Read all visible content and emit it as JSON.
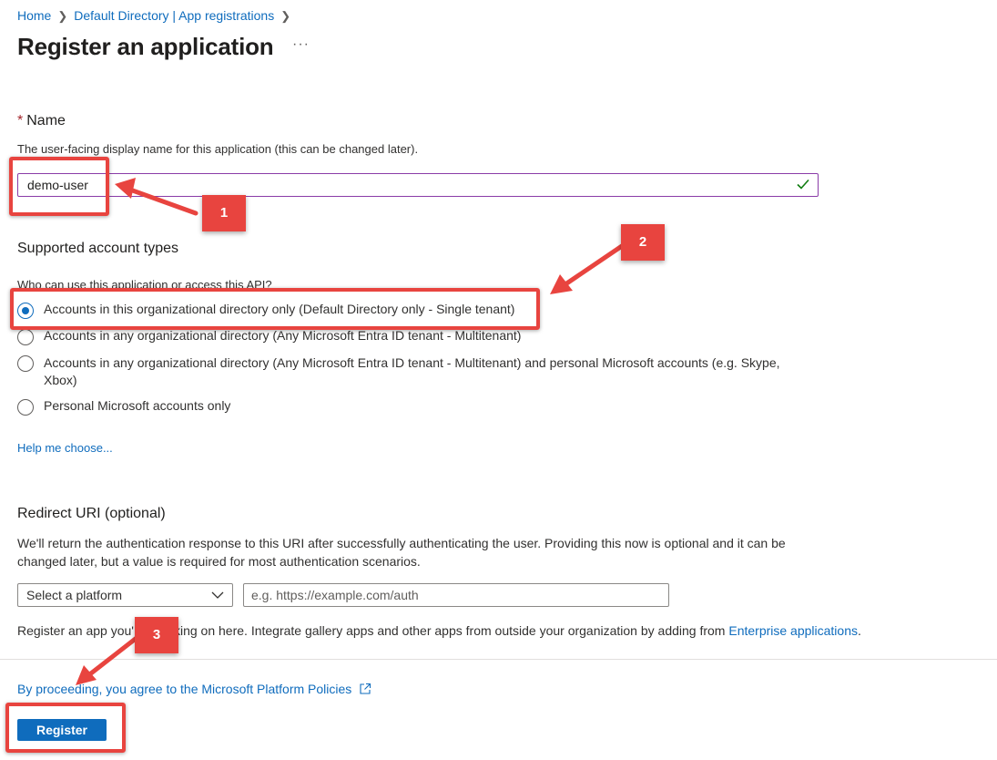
{
  "breadcrumb": {
    "items": [
      "Home",
      "Default Directory | App registrations"
    ]
  },
  "page": {
    "title": "Register an application",
    "more_label": "···"
  },
  "name_section": {
    "required_mark": "*",
    "label": "Name",
    "help": "The user-facing display name for this application (this can be changed later).",
    "value": "demo-user",
    "valid_icon": "checkmark-icon"
  },
  "account_types": {
    "label": "Supported account types",
    "question": "Who can use this application or access this API?",
    "options": [
      {
        "label": "Accounts in this organizational directory only (Default Directory only - Single tenant)",
        "selected": true
      },
      {
        "label": "Accounts in any organizational directory (Any Microsoft Entra ID tenant - Multitenant)",
        "selected": false
      },
      {
        "label": "Accounts in any organizational directory (Any Microsoft Entra ID tenant - Multitenant) and personal Microsoft accounts (e.g. Skype, Xbox)",
        "selected": false
      },
      {
        "label": "Personal Microsoft accounts only",
        "selected": false
      }
    ],
    "help_link": "Help me choose..."
  },
  "redirect": {
    "label": "Redirect URI (optional)",
    "description": "We'll return the authentication response to this URI after successfully authenticating the user. Providing this now is optional and it can be changed later, but a value is required for most authentication scenarios.",
    "platform_select": "Select a platform",
    "uri_placeholder": "e.g. https://example.com/auth"
  },
  "footer_note": {
    "text_a": "Register an app you'",
    "text_b": "king on here. Integrate gallery apps and other apps from outside your organization by adding from ",
    "link": "Enterprise applications",
    "text_end": "."
  },
  "policy": {
    "link_a": "By procee",
    "link_b": "ding, you agree to the Microsoft Platform Policies",
    "icon": "external-link-icon"
  },
  "actions": {
    "register_label": "Register"
  },
  "annotations": {
    "badges": [
      "1",
      "2",
      "3"
    ],
    "color": "#e8443f"
  },
  "colors": {
    "accent": "#0f6cbd",
    "annotation": "#e8443f",
    "input_focus": "#8a3ca8",
    "valid": "#107c10"
  }
}
